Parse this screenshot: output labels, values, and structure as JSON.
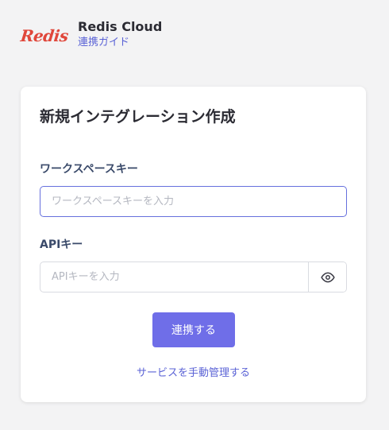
{
  "header": {
    "logo_text": "Redis",
    "app_name": "Redis Cloud",
    "guide_link": "連携ガイド"
  },
  "card": {
    "title": "新規インテグレーション作成",
    "workspace_key": {
      "label": "ワークスペースキー",
      "placeholder": "ワークスペースキーを入力",
      "value": ""
    },
    "api_key": {
      "label": "APIキー",
      "placeholder": "APIキーを入力",
      "value": ""
    },
    "connect_button": "連携する",
    "manual_link": "サービスを手動管理する"
  },
  "colors": {
    "accent": "#6f6ee8",
    "link": "#5b63d6",
    "logo": "#e0473b",
    "background": "#f3f3f4"
  },
  "icons": {
    "visibility_toggle": "eye-icon"
  }
}
